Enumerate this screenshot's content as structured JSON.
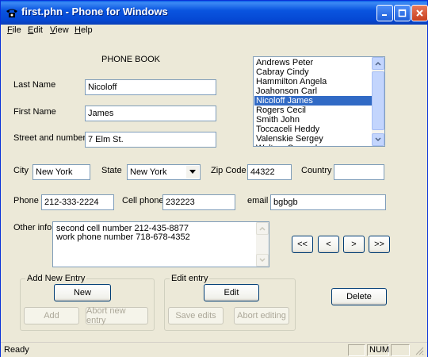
{
  "window": {
    "title": "first.phn - Phone for Windows"
  },
  "menu": [
    {
      "label": "File",
      "accel": "F",
      "rest": "ile"
    },
    {
      "label": "Edit",
      "accel": "E",
      "rest": "dit"
    },
    {
      "label": "View",
      "accel": "V",
      "rest": "iew"
    },
    {
      "label": "Help",
      "accel": "H",
      "rest": "elp"
    }
  ],
  "heading": "PHONE BOOK",
  "form": {
    "last_name_label": "Last Name",
    "last_name": "Nicoloff",
    "first_name_label": "First Name",
    "first_name": "James",
    "street_label": "Street and number",
    "street": "7 Elm St.",
    "city_label": "City",
    "city": "New York",
    "state_label": "State",
    "state": "New York",
    "zip_label": "Zip Code",
    "zip": "44322",
    "country_label": "Country",
    "country": "",
    "phone_label": "Phone",
    "phone": "212-333-2224",
    "cell_label": "Cell phone",
    "cell": "232223",
    "email_label": "email",
    "email": "bgbgb",
    "other_label": "Other info",
    "other_line1": "second cell number 212-435-8877",
    "other_line2": "work phone number 718-678-4352"
  },
  "contacts": [
    "Andrews Peter",
    "Cabray Cindy",
    "Hammilton Angela",
    "Joahonson Carl",
    "Nicoloff James",
    "Rogers Cecil",
    "Smith John",
    "Toccaceli Heddy",
    "Valenskie Sergey",
    "Walters Samuel"
  ],
  "selected_contact": "Nicoloff James",
  "nav": {
    "first": "<<",
    "prev": "<",
    "next": ">",
    "last": ">>"
  },
  "add_group": {
    "title": "Add New Entry",
    "new": "New",
    "add": "Add",
    "abort": "Abort new entry"
  },
  "edit_group": {
    "title": "Edit entry",
    "edit": "Edit",
    "save": "Save edits",
    "abort": "Abort editing"
  },
  "delete_label": "Delete",
  "status": {
    "text": "Ready",
    "num": "NUM"
  },
  "colors": {
    "titlebar": "#0A55E0",
    "selection": "#316AC5",
    "background": "#ECE9D8"
  }
}
